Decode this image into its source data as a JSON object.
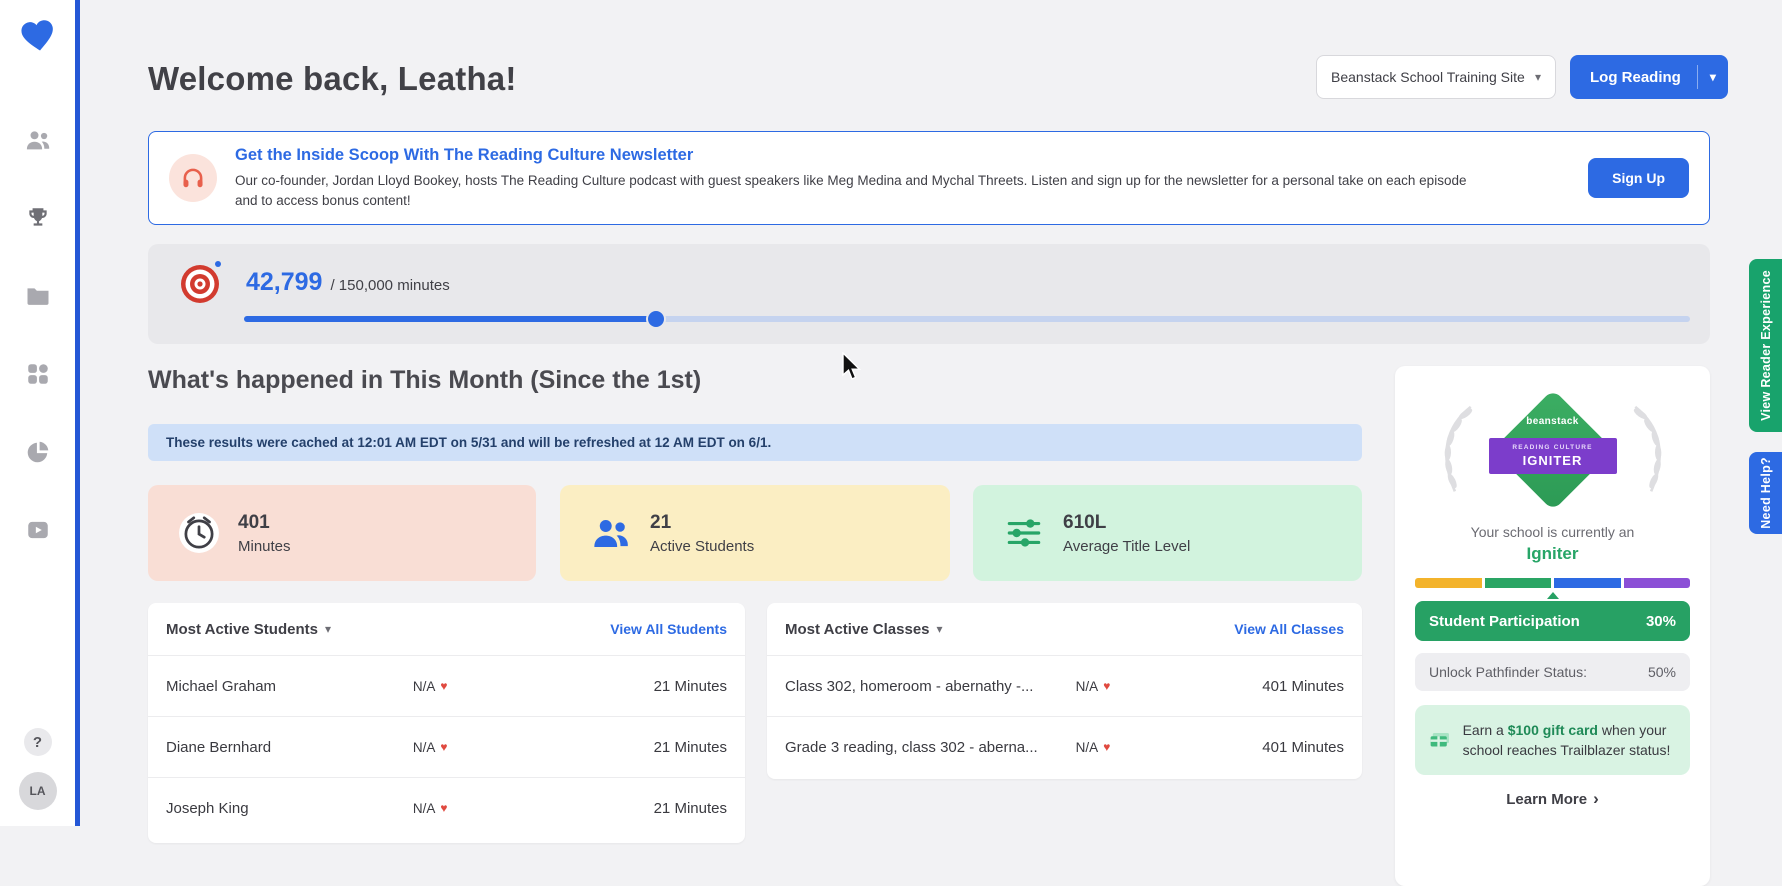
{
  "colors": {
    "accent_blue": "#2d6ae3",
    "sidebar_accent": "#2457d6",
    "brand_green": "#27a567",
    "badge_green": "#35a85e",
    "badge_purple": "#7c3dcb",
    "alert_red": "#e0493f",
    "card_pink": "#f9ded5",
    "card_yellow": "#fbeec3",
    "card_green": "#d2f3de",
    "cache_banner_blue": "#cfe0f8",
    "reader_tab_green": "#18a36c"
  },
  "sidebar": {
    "icon_names": [
      "students-icon",
      "awards-icon",
      "folders-icon",
      "apps-icon",
      "reports-icon",
      "videos-icon"
    ],
    "help_glyph": "?",
    "avatar_initials": "LA"
  },
  "header": {
    "greeting": "Welcome back, Leatha!",
    "site_selector": "Beanstack School Training Site",
    "log_reading": "Log Reading"
  },
  "newsletter": {
    "title": "Get the Inside Scoop With The Reading Culture Newsletter",
    "body": "Our co-founder, Jordan Lloyd Bookey, hosts The Reading Culture podcast with guest speakers like Meg Medina and Mychal Threets. Listen and sign up for the newsletter for a personal take on each episode and to access bonus content!",
    "signup_label": "Sign Up"
  },
  "progress": {
    "current": "42,799",
    "total": "/ 150,000 minutes",
    "percent": 28.5
  },
  "month_section": {
    "title": "What's happened in This Month (Since the 1st)",
    "cache_notice": "These results were cached at 12:01 AM EDT on 5/31 and will be refreshed at 12 AM EDT on 6/1."
  },
  "stats": [
    {
      "value": "401",
      "label": "Minutes",
      "icon": "clock-icon"
    },
    {
      "value": "21",
      "label": "Active Students",
      "icon": "active-students-icon"
    },
    {
      "value": "610L",
      "label": "Average Title Level",
      "icon": "title-level-icon"
    }
  ],
  "students_table": {
    "title": "Most Active Students",
    "view_all": "View All Students",
    "rows": [
      {
        "name": "Michael Graham",
        "badge": "N/A",
        "minutes": "21 Minutes"
      },
      {
        "name": "Diane Bernhard",
        "badge": "N/A",
        "minutes": "21 Minutes"
      },
      {
        "name": "Joseph King",
        "badge": "N/A",
        "minutes": "21 Minutes"
      }
    ]
  },
  "classes_table": {
    "title": "Most Active Classes",
    "view_all": "View All Classes",
    "rows": [
      {
        "name": "Class 302, homeroom - abernathy -...",
        "badge": "N/A",
        "minutes": "401 Minutes"
      },
      {
        "name": "Grade 3 reading, class 302 - aberna...",
        "badge": "N/A",
        "minutes": "401 Minutes"
      }
    ]
  },
  "status_panel": {
    "badge_brand": "beanstack",
    "badge_line1": "READING CULTURE",
    "badge_line2": "IGNITER",
    "status_prefix": "Your school is currently an",
    "status_name": "Igniter",
    "participation_label": "Student Participation",
    "participation_value": "30%",
    "unlock_label": "Unlock Pathfinder Status:",
    "unlock_value": "50%",
    "promo_pre": "Earn a",
    "promo_highlight": "$100 gift card",
    "promo_post": "when your school reaches Trailblazer status!",
    "learn_more": "Learn More",
    "tier_colors": [
      "#f3b32b",
      "#2aa564",
      "#2d6ae3",
      "#8b4fd6"
    ]
  },
  "edge_tabs": {
    "reader_experience": "View Reader Experience",
    "need_help": "Need Help?"
  },
  "icons": {
    "chevron_down": "▾",
    "chevron_right": "›",
    "heart": "♥"
  }
}
